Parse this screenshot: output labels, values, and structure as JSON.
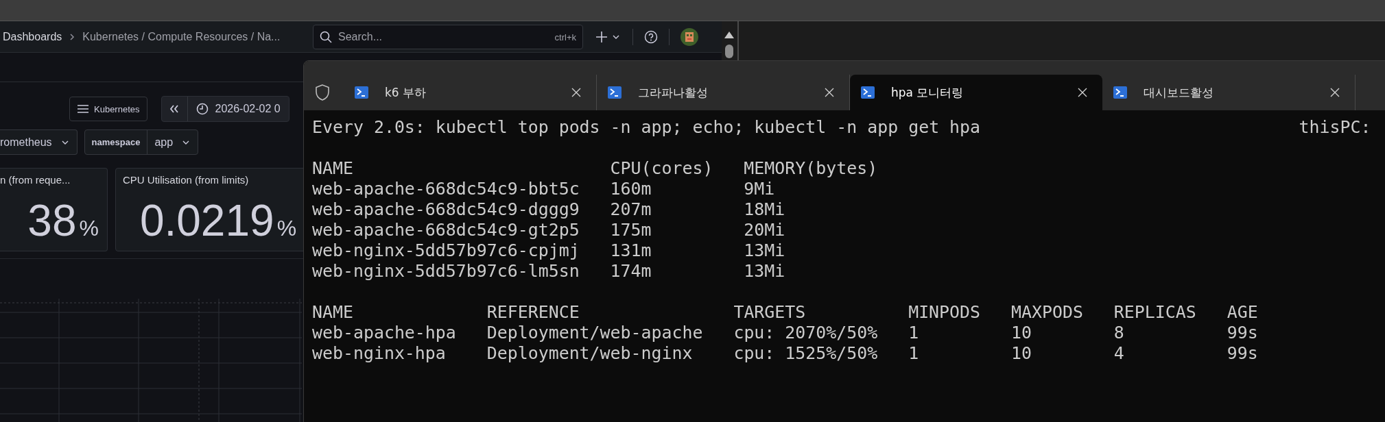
{
  "grafana": {
    "breadcrumbs": [
      "Dashboards",
      "Kubernetes / Compute Resources / Na..."
    ],
    "search": {
      "placeholder": "Search...",
      "shortcut": "ctrl+k"
    },
    "dashboard_link": "Kubernetes",
    "time_range": "2026-02-02 0",
    "variables": [
      {
        "value": "rometheus"
      },
      {
        "label": "namespace",
        "value": "app"
      }
    ],
    "stats": [
      {
        "title": "n (from reque...",
        "value": "38",
        "unit": "%"
      },
      {
        "title": "CPU Utilisation (from limits)",
        "value": "0.0219",
        "unit": "%"
      }
    ]
  },
  "terminal": {
    "tabs": [
      {
        "title": "k6 부하",
        "selected": false
      },
      {
        "title": "그라파나활성",
        "selected": false
      },
      {
        "title": "hpa 모니터링",
        "selected": true
      },
      {
        "title": "대시보드활성",
        "selected": false
      }
    ],
    "header": {
      "command": "Every 2.0s: kubectl top pods -n app; echo; kubectl -n app get hpa",
      "host": "thisPC:"
    },
    "tables": [
      {
        "columns": [
          "NAME",
          "CPU(cores)",
          "MEMORY(bytes)"
        ],
        "rows": [
          [
            "web-apache-668dc54c9-bbt5c",
            "160m",
            "9Mi"
          ],
          [
            "web-apache-668dc54c9-dggg9",
            "207m",
            "18Mi"
          ],
          [
            "web-apache-668dc54c9-gt2p5",
            "175m",
            "20Mi"
          ],
          [
            "web-nginx-5dd57b97c6-cpjmj",
            "131m",
            "13Mi"
          ],
          [
            "web-nginx-5dd57b97c6-lm5sn",
            "174m",
            "13Mi"
          ]
        ]
      },
      {
        "columns": [
          "NAME",
          "REFERENCE",
          "TARGETS",
          "MINPODS",
          "MAXPODS",
          "REPLICAS",
          "AGE"
        ],
        "rows": [
          [
            "web-apache-hpa",
            "Deployment/web-apache",
            "cpu: 2070%/50%",
            "1",
            "10",
            "8",
            "99s"
          ],
          [
            "web-nginx-hpa",
            "Deployment/web-nginx",
            "cpu: 1525%/50%",
            "1",
            "10",
            "4",
            "99s"
          ]
        ]
      }
    ]
  }
}
